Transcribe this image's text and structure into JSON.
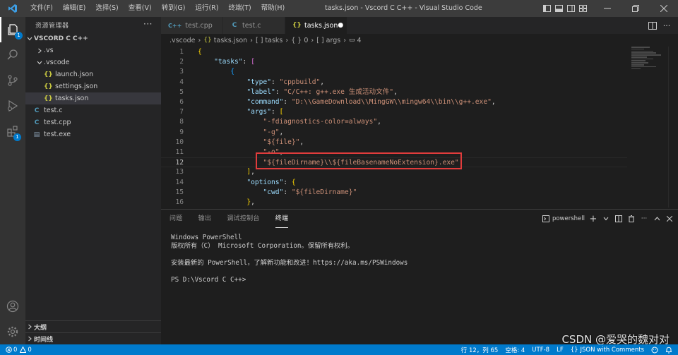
{
  "titlebar": {
    "menu": [
      "文件(F)",
      "编辑(E)",
      "选择(S)",
      "查看(V)",
      "转到(G)",
      "运行(R)",
      "终端(T)",
      "帮助(H)"
    ],
    "window_title": "tasks.json - Vscord C C++ - Visual Studio Code"
  },
  "activitybar": {
    "explorer_badge": "1",
    "extensions_badge": "1"
  },
  "sidebar": {
    "title": "资源管理器",
    "more": "···",
    "folder_name": "VSCORD C C++",
    "items": [
      {
        "label": ".vs",
        "type": "folder",
        "expanded": false
      },
      {
        "label": ".vscode",
        "type": "folder",
        "expanded": true
      },
      {
        "label": "launch.json",
        "type": "json"
      },
      {
        "label": "settings.json",
        "type": "json"
      },
      {
        "label": "tasks.json",
        "type": "json",
        "selected": true
      },
      {
        "label": "test.c",
        "type": "c"
      },
      {
        "label": "test.cpp",
        "type": "cpp"
      },
      {
        "label": "test.exe",
        "type": "exe"
      }
    ],
    "outline": "大纲",
    "timeline": "时间线"
  },
  "tabs": [
    {
      "label": "test.cpp",
      "icon": "C++"
    },
    {
      "label": "test.c",
      "icon": "C"
    },
    {
      "label": "tasks.json",
      "icon": "{}",
      "active": true,
      "modified": "●"
    }
  ],
  "breadcrumb": [
    ".vscode",
    "tasks.json",
    "[ ] tasks",
    "{ } 0",
    "[ ] args",
    "4"
  ],
  "editor": {
    "current_line": 12,
    "lines": [
      {
        "n": "1",
        "segs": [
          [
            "b1",
            "{"
          ]
        ]
      },
      {
        "n": "2",
        "segs": [
          [
            "p",
            "    "
          ],
          [
            "k",
            "\"tasks\""
          ],
          [
            "p",
            ": "
          ],
          [
            "b2",
            "["
          ]
        ]
      },
      {
        "n": "3",
        "segs": [
          [
            "p",
            "        "
          ],
          [
            "b3",
            "{"
          ]
        ]
      },
      {
        "n": "4",
        "segs": [
          [
            "p",
            "            "
          ],
          [
            "k",
            "\"type\""
          ],
          [
            "p",
            ": "
          ],
          [
            "s",
            "\"cppbuild\""
          ],
          [
            "p",
            ","
          ]
        ]
      },
      {
        "n": "5",
        "segs": [
          [
            "p",
            "            "
          ],
          [
            "k",
            "\"label\""
          ],
          [
            "p",
            ": "
          ],
          [
            "s",
            "\"C/C++: g++.exe 生成活动文件\""
          ],
          [
            "p",
            ","
          ]
        ]
      },
      {
        "n": "6",
        "segs": [
          [
            "p",
            "            "
          ],
          [
            "k",
            "\"command\""
          ],
          [
            "p",
            ": "
          ],
          [
            "s",
            "\"D:\\\\GameDownload\\\\MingGW\\\\mingw64\\\\bin\\\\g++.exe\""
          ],
          [
            "p",
            ","
          ]
        ]
      },
      {
        "n": "7",
        "segs": [
          [
            "p",
            "            "
          ],
          [
            "k",
            "\"args\""
          ],
          [
            "p",
            ": "
          ],
          [
            "b1",
            "["
          ]
        ]
      },
      {
        "n": "8",
        "segs": [
          [
            "p",
            "                "
          ],
          [
            "s",
            "\"-fdiagnostics-color=always\""
          ],
          [
            "p",
            ","
          ]
        ]
      },
      {
        "n": "9",
        "segs": [
          [
            "p",
            "                "
          ],
          [
            "s",
            "\"-g\""
          ],
          [
            "p",
            ","
          ]
        ]
      },
      {
        "n": "10",
        "segs": [
          [
            "p",
            "                "
          ],
          [
            "s",
            "\"${file}\""
          ],
          [
            "p",
            ","
          ]
        ]
      },
      {
        "n": "11",
        "segs": [
          [
            "p",
            "                "
          ],
          [
            "s",
            "\"-o\""
          ],
          [
            "p",
            ","
          ]
        ]
      },
      {
        "n": "12",
        "segs": [
          [
            "p",
            "                "
          ],
          [
            "s",
            "\"${fileDirname}\\\\${fileBasenameNoExtension}.exe\""
          ]
        ]
      },
      {
        "n": "13",
        "segs": [
          [
            "p",
            "            "
          ],
          [
            "b1",
            "]"
          ],
          [
            "p",
            ","
          ]
        ]
      },
      {
        "n": "14",
        "segs": [
          [
            "p",
            "            "
          ],
          [
            "k",
            "\"options\""
          ],
          [
            "p",
            ": "
          ],
          [
            "b1",
            "{"
          ]
        ]
      },
      {
        "n": "15",
        "segs": [
          [
            "p",
            "                "
          ],
          [
            "k",
            "\"cwd\""
          ],
          [
            "p",
            ": "
          ],
          [
            "s",
            "\"${fileDirname}\""
          ]
        ]
      },
      {
        "n": "16",
        "segs": [
          [
            "p",
            "            "
          ],
          [
            "b1",
            "}"
          ],
          [
            "p",
            ","
          ]
        ]
      }
    ]
  },
  "panel": {
    "tabs": [
      "问题",
      "输出",
      "调试控制台",
      "终端"
    ],
    "active_tab": 3,
    "shell": "powershell",
    "terminal_lines": [
      "Windows PowerShell",
      "版权所有（C） Microsoft Corporation。保留所有权利。",
      "",
      "安装最新的 PowerShell，了解新功能和改进！https://aka.ms/PSWindows",
      "",
      "PS D:\\Vscord C C++>"
    ]
  },
  "statusbar": {
    "errors": "0",
    "warnings": "0",
    "position": "行 12，列 65",
    "indent": "空格: 4",
    "encoding": "UTF-8",
    "eol": "LF",
    "language": "JSON with Comments"
  },
  "watermark": "CSDN @爱哭的魏对对",
  "colors": {
    "accent": "#007acc",
    "highlight_box": "#e03c3c"
  }
}
